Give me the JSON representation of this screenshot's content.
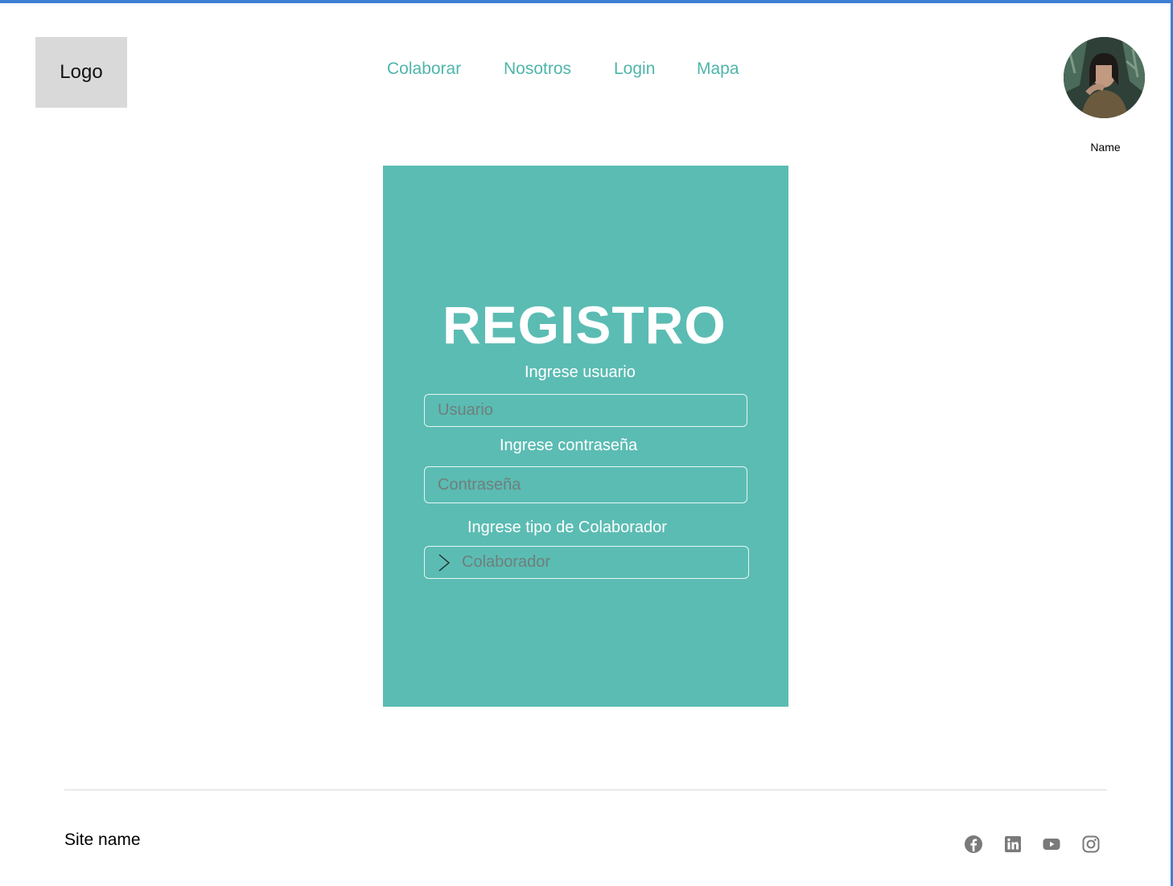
{
  "header": {
    "logo_text": "Logo",
    "nav": [
      {
        "label": "Colaborar"
      },
      {
        "label": "Nosotros"
      },
      {
        "label": "Login"
      },
      {
        "label": "Mapa"
      }
    ],
    "profile_name": "Name"
  },
  "form": {
    "title": "REGISTRO",
    "user_label": "Ingrese usuario",
    "user_placeholder": "Usuario",
    "password_label": "Ingrese contraseña",
    "password_placeholder": "Contraseña",
    "type_label": "Ingrese tipo de Colaborador",
    "type_value": "Colaborador"
  },
  "footer": {
    "site_name": "Site name",
    "social_icons": [
      "facebook-icon",
      "linkedin-icon",
      "youtube-icon",
      "instagram-icon"
    ]
  },
  "colors": {
    "accent": "#4fb5ab",
    "card": "#5bbcb3",
    "frame": "#3d7fd3"
  }
}
